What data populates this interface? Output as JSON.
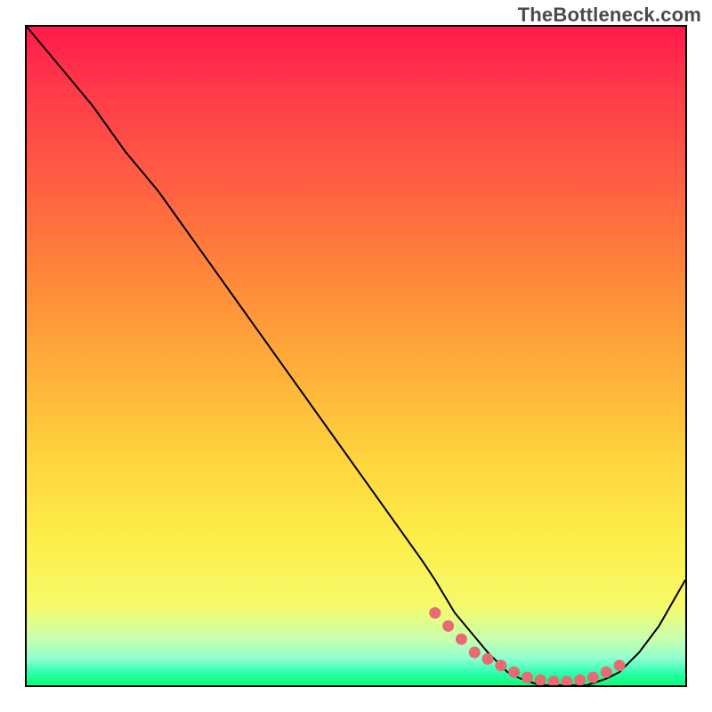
{
  "watermark": "TheBottleneck.com",
  "chart_data": {
    "type": "line",
    "title": "",
    "xlabel": "",
    "ylabel": "",
    "xlim": [
      0,
      100
    ],
    "ylim": [
      0,
      100
    ],
    "grid": false,
    "legend": false,
    "series": [
      {
        "name": "curve",
        "color": "#000000",
        "x": [
          0,
          5,
          10,
          15,
          20,
          25,
          30,
          35,
          40,
          45,
          50,
          55,
          60,
          62,
          65,
          70,
          73,
          75,
          78,
          80,
          82,
          85,
          88,
          90,
          93,
          96,
          100
        ],
        "y": [
          100,
          94,
          88,
          81,
          75,
          68,
          61,
          54,
          47,
          40,
          33,
          26,
          19,
          16,
          11,
          5,
          2,
          1,
          0,
          0,
          0,
          0,
          1,
          2,
          5,
          9,
          16
        ]
      }
    ],
    "highlight": {
      "name": "optimal-range",
      "color": "#e86b74",
      "x": [
        62,
        64,
        66,
        68,
        70,
        72,
        74,
        76,
        78,
        80,
        82,
        84,
        86,
        88,
        90
      ],
      "y": [
        11,
        9,
        7,
        5,
        4,
        3,
        2,
        1.2,
        0.8,
        0.6,
        0.6,
        0.8,
        1.2,
        2,
        3
      ]
    },
    "gradient": {
      "direction": "vertical",
      "stops": [
        {
          "pos": 0.0,
          "color": "#ff1a4b"
        },
        {
          "pos": 0.22,
          "color": "#ff5a44"
        },
        {
          "pos": 0.44,
          "color": "#ff993a"
        },
        {
          "pos": 0.66,
          "color": "#ffd53e"
        },
        {
          "pos": 0.88,
          "color": "#f6fa6b"
        },
        {
          "pos": 0.96,
          "color": "#8effd0"
        },
        {
          "pos": 1.0,
          "color": "#05ff7a"
        }
      ]
    }
  }
}
